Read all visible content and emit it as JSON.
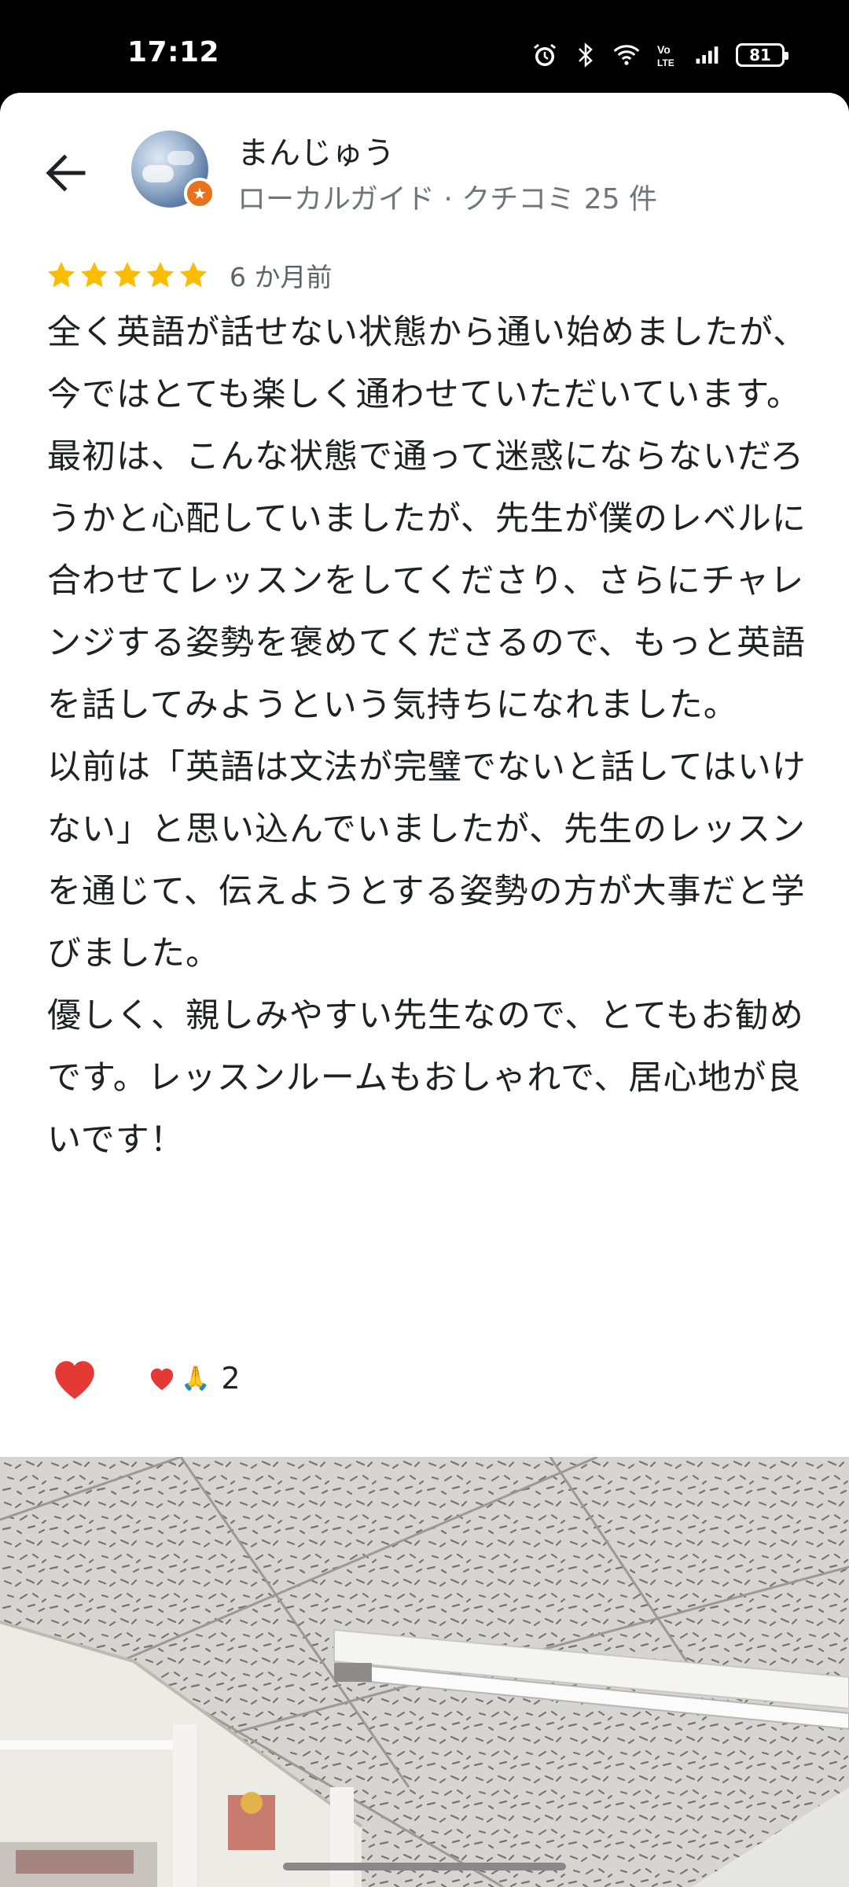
{
  "status_bar": {
    "time": "17:12",
    "icons": [
      "alarm-icon",
      "bluetooth-icon",
      "wifi-icon",
      "volte-icon",
      "signal-icon"
    ],
    "battery": "81"
  },
  "reviewer": {
    "name": "まんじゅう",
    "subtitle": "ローカルガイド · クチコミ 25 件"
  },
  "rating": {
    "stars": 5,
    "time_ago": "6 か月前"
  },
  "review": {
    "paragraphs": [
      "全く英語が話せない状態から通い始めましたが、今ではとても楽しく通わせていただいています。",
      "最初は、こんな状態で通って迷惑にならないだろうかと心配していましたが、先生が僕のレベルに合わせてレッスンをしてくださり、さらにチャレンジする姿勢を褒めてくださるので、もっと英語を話してみようという気持ちになれました。",
      "以前は「英語は文法が完璧でないと話してはいけない」と思い込んでいましたが、先生のレッスンを通じて、伝えようとする姿勢の方が大事だと学びました。",
      "優しく、親しみやすい先生なので、とてもお勧めです。レッスンルームもおしゃれで、居心地が良いです！"
    ]
  },
  "reactions": {
    "summary_emojis": [
      "heart-icon",
      "pray-icon"
    ],
    "pray_glyph": "🙏",
    "count": "2"
  },
  "colors": {
    "star": "#fbbc04",
    "heart": "#e53935",
    "local_guide": "#e8711c"
  }
}
